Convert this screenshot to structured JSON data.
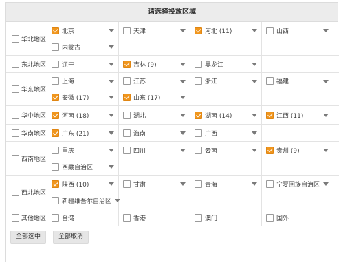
{
  "title": "请选择投放区域",
  "buttons": {
    "select_all": "全部选中",
    "cancel_all": "全部取消"
  },
  "regions": [
    {
      "name": "华北地区",
      "checked": false,
      "rows": [
        [
          {
            "name": "北京",
            "checked": true,
            "dropdown": true
          },
          {
            "name": "天津",
            "checked": false,
            "dropdown": true
          },
          {
            "name": "河北 (11)",
            "checked": true,
            "dropdown": true
          },
          {
            "name": "山西",
            "checked": false,
            "dropdown": true
          }
        ],
        [
          {
            "name": "内蒙古",
            "checked": false,
            "dropdown": true
          }
        ]
      ]
    },
    {
      "name": "东北地区",
      "checked": false,
      "rows": [
        [
          {
            "name": "辽宁",
            "checked": false,
            "dropdown": true
          },
          {
            "name": "吉林 (9)",
            "checked": true,
            "dropdown": true
          },
          {
            "name": "黑龙江",
            "checked": false,
            "dropdown": true
          }
        ]
      ]
    },
    {
      "name": "华东地区",
      "checked": false,
      "rows": [
        [
          {
            "name": "上海",
            "checked": false,
            "dropdown": true
          },
          {
            "name": "江苏",
            "checked": false,
            "dropdown": true
          },
          {
            "name": "浙江",
            "checked": false,
            "dropdown": true
          },
          {
            "name": "福建",
            "checked": false,
            "dropdown": true
          }
        ],
        [
          {
            "name": "安徽 (17)",
            "checked": true,
            "dropdown": true
          },
          {
            "name": "山东 (17)",
            "checked": true,
            "dropdown": true
          }
        ]
      ]
    },
    {
      "name": "华中地区",
      "checked": false,
      "rows": [
        [
          {
            "name": "河南 (18)",
            "checked": true,
            "dropdown": true
          },
          {
            "name": "湖北",
            "checked": false,
            "dropdown": true
          },
          {
            "name": "湖南 (14)",
            "checked": true,
            "dropdown": true
          },
          {
            "name": "江西 (11)",
            "checked": true,
            "dropdown": true
          }
        ]
      ]
    },
    {
      "name": "华南地区",
      "checked": false,
      "rows": [
        [
          {
            "name": "广东 (21)",
            "checked": true,
            "dropdown": true
          },
          {
            "name": "海南",
            "checked": false,
            "dropdown": true
          },
          {
            "name": "广西",
            "checked": false,
            "dropdown": true
          }
        ]
      ]
    },
    {
      "name": "西南地区",
      "checked": false,
      "rows": [
        [
          {
            "name": "重庆",
            "checked": false,
            "dropdown": true
          },
          {
            "name": "四川",
            "checked": false,
            "dropdown": true
          },
          {
            "name": "云南",
            "checked": false,
            "dropdown": true
          },
          {
            "name": "贵州 (9)",
            "checked": true,
            "dropdown": true
          }
        ],
        [
          {
            "name": "西藏自治区",
            "checked": false,
            "dropdown": true
          }
        ]
      ]
    },
    {
      "name": "西北地区",
      "checked": false,
      "rows": [
        [
          {
            "name": "陕西 (10)",
            "checked": true,
            "dropdown": true
          },
          {
            "name": "甘肃",
            "checked": false,
            "dropdown": true
          },
          {
            "name": "青海",
            "checked": false,
            "dropdown": true
          },
          {
            "name": "宁夏回族自治区",
            "checked": false,
            "dropdown": true
          }
        ],
        [
          {
            "name": "新疆维吾尔自治区",
            "checked": false,
            "dropdown": true
          }
        ]
      ]
    },
    {
      "name": "其他地区",
      "checked": false,
      "rows": [
        [
          {
            "name": "台湾",
            "checked": false,
            "dropdown": false
          },
          {
            "name": "香港",
            "checked": false,
            "dropdown": false
          },
          {
            "name": "澳门",
            "checked": false,
            "dropdown": false
          },
          {
            "name": "国外",
            "checked": false,
            "dropdown": false
          }
        ]
      ]
    }
  ]
}
